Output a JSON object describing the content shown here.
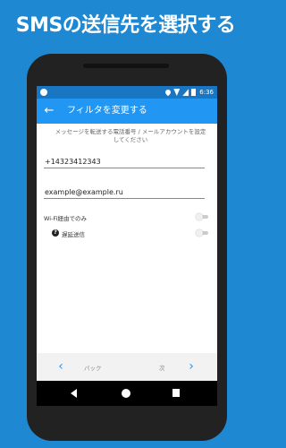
{
  "headline": "SMSの送信先を選択する",
  "statusbar": {
    "time": "6:36",
    "icons": [
      "app-notification-icon",
      "location-icon",
      "wifi-icon",
      "signal-icon",
      "battery-icon"
    ]
  },
  "toolbar": {
    "title": "フィルタを変更する",
    "back_icon": "←"
  },
  "form": {
    "description": "メッセージを転送する電話番号 / メールアカウントを設定してください",
    "phone_value": "+14323412343",
    "email_value": "example@example.ru"
  },
  "settings": {
    "wifi_only_label": "Wi-Fi経由でのみ",
    "wifi_only_on": false,
    "delayed_send_label": "遅延送信",
    "delayed_send_on": false,
    "help_icon": "?"
  },
  "navigation": {
    "prev_icon": "‹",
    "back_label": "バック",
    "next_label": "次",
    "next_icon": "›"
  },
  "colors": {
    "background": "#1e88d2",
    "statusbar": "#1976c2",
    "toolbar": "#2196f3",
    "accent": "#2196f3"
  }
}
